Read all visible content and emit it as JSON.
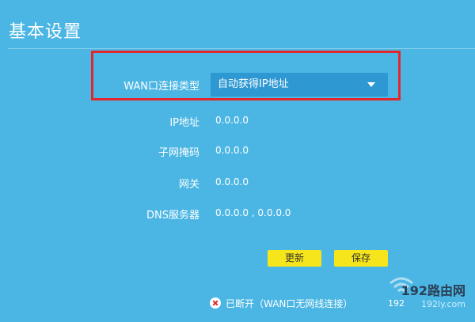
{
  "page": {
    "title": "基本设置"
  },
  "form": {
    "wan_type": {
      "label": "WAN口连接类型",
      "selected": "自动获得IP地址"
    },
    "ip": {
      "label": "IP地址",
      "value": "0.0.0.0"
    },
    "subnet": {
      "label": "子网掩码",
      "value": "0.0.0.0"
    },
    "gateway": {
      "label": "网关",
      "value": "0.0.0.0"
    },
    "dns": {
      "label": "DNS服务器",
      "value": "0.0.0.0 , 0.0.0.0"
    }
  },
  "buttons": {
    "refresh": "更新",
    "save": "保存"
  },
  "status": {
    "text": "已断开（WAN口无网线连接）",
    "icon": "error-icon"
  },
  "watermark": {
    "title": "192路由网",
    "url": "192ly.com",
    "small": "192"
  },
  "colors": {
    "background": "#4bb6e3",
    "select": "#2e98d3",
    "highlight": "#e3262b",
    "button": "#f6e51b"
  }
}
